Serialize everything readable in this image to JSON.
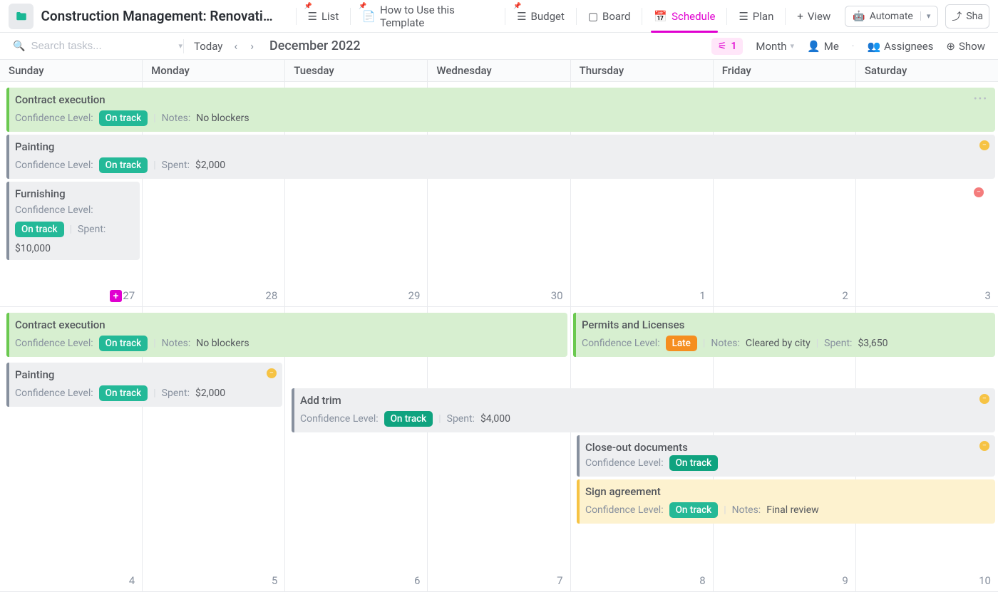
{
  "header": {
    "page_title": "Construction Management: Renovatio...",
    "tabs": [
      {
        "label": "List",
        "icon": "list-icon",
        "pinned": true
      },
      {
        "label": "How to Use this Template",
        "icon": "doc-icon",
        "pinned": true
      },
      {
        "label": "Budget",
        "icon": "list-icon",
        "pinned": true
      },
      {
        "label": "Board",
        "icon": "board-icon",
        "pinned": false
      },
      {
        "label": "Schedule",
        "icon": "calendar-icon",
        "pinned": false,
        "active": true
      },
      {
        "label": "Plan",
        "icon": "list-icon",
        "pinned": false
      },
      {
        "label": "View",
        "icon": "plus-icon",
        "pinned": false
      }
    ],
    "automate_label": "Automate",
    "share_label": "Sha"
  },
  "sub": {
    "search_placeholder": "Search tasks...",
    "today_label": "Today",
    "calendar_title": "December 2022",
    "filter_count": "1",
    "month_label": "Month",
    "me_label": "Me",
    "assignees_label": "Assignees",
    "show_label": "Show"
  },
  "days": [
    "Sunday",
    "Monday",
    "Tuesday",
    "Wednesday",
    "Thursday",
    "Friday",
    "Saturday"
  ],
  "row1_dates": [
    "27",
    "28",
    "29",
    "30",
    "1",
    "2",
    "3"
  ],
  "row2_dates": [
    "4",
    "5",
    "6",
    "7",
    "8",
    "9",
    "10"
  ],
  "labels": {
    "confidence": "Confidence Level:",
    "notes": "Notes:",
    "spent": "Spent:"
  },
  "events": {
    "w1": [
      {
        "id": "contract1",
        "title": "Contract execution",
        "color": "green",
        "badge": "On track",
        "badge_style": "teal",
        "notes": "No blockers",
        "dots": true
      },
      {
        "id": "painting1",
        "title": "Painting",
        "color": "grey",
        "badge": "On track",
        "badge_style": "teal",
        "spent": "$2,000",
        "status": "y"
      },
      {
        "id": "furnishing",
        "title": "Furnishing",
        "color": "grey",
        "badge": "On track",
        "badge_style": "teal",
        "spent": "$10,000",
        "status": "r"
      }
    ],
    "w2": {
      "contract2": {
        "title": "Contract execution",
        "badge": "On track",
        "notes": "No blockers"
      },
      "permits": {
        "title": "Permits and Licenses",
        "badge": "Late",
        "notes": "Cleared by city",
        "spent": "$3,650"
      },
      "painting2": {
        "title": "Painting",
        "badge": "On track",
        "spent": "$2,000"
      },
      "addtrim": {
        "title": "Add trim",
        "badge": "On track",
        "spent": "$4,000"
      },
      "closeout": {
        "title": "Close-out documents",
        "badge": "On track"
      },
      "sign": {
        "title": "Sign agreement",
        "badge": "On track",
        "notes": "Final review"
      }
    }
  }
}
